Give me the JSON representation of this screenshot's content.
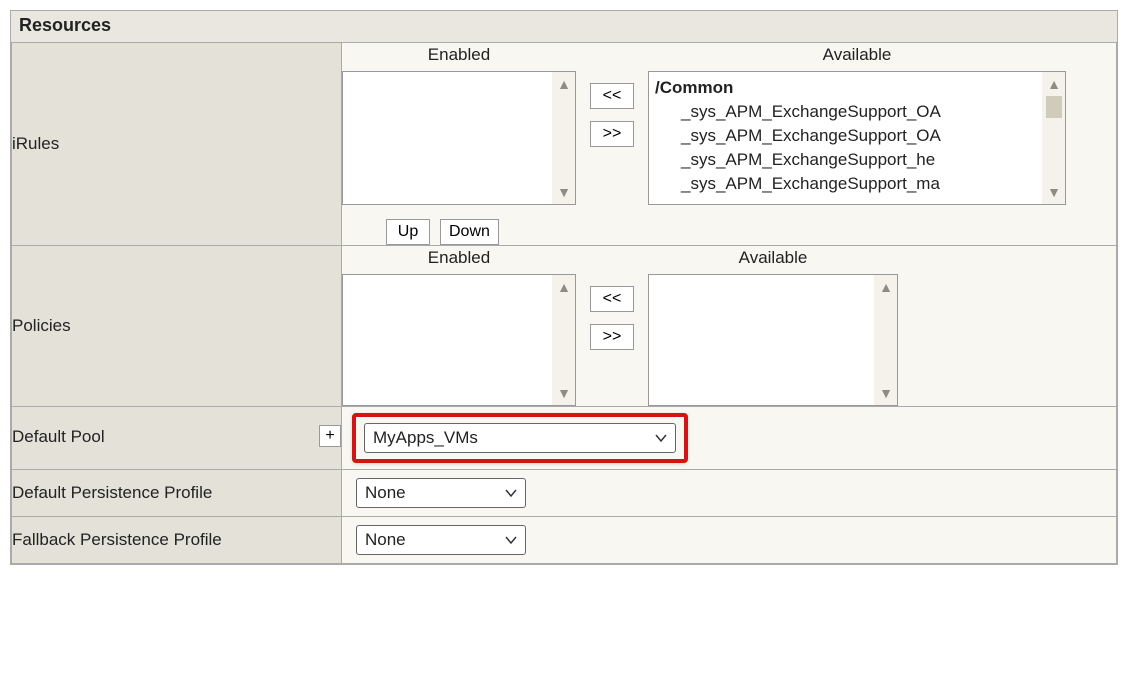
{
  "panel": {
    "title": "Resources"
  },
  "rows": {
    "irules": {
      "label": "iRules",
      "enabled_header": "Enabled",
      "available_header": "Available",
      "available_group": "/Common",
      "available_items": [
        "_sys_APM_ExchangeSupport_OA",
        "_sys_APM_ExchangeSupport_OA",
        "_sys_APM_ExchangeSupport_he",
        "_sys_APM_ExchangeSupport_ma"
      ],
      "move_left": "<<",
      "move_right": ">>",
      "up_label": "Up",
      "down_label": "Down"
    },
    "policies": {
      "label": "Policies",
      "enabled_header": "Enabled",
      "available_header": "Available",
      "move_left": "<<",
      "move_right": ">>"
    },
    "default_pool": {
      "label": "Default Pool",
      "plus": "+",
      "value": "MyApps_VMs"
    },
    "default_persist": {
      "label": "Default Persistence Profile",
      "value": "None"
    },
    "fallback_persist": {
      "label": "Fallback Persistence Profile",
      "value": "None"
    }
  }
}
